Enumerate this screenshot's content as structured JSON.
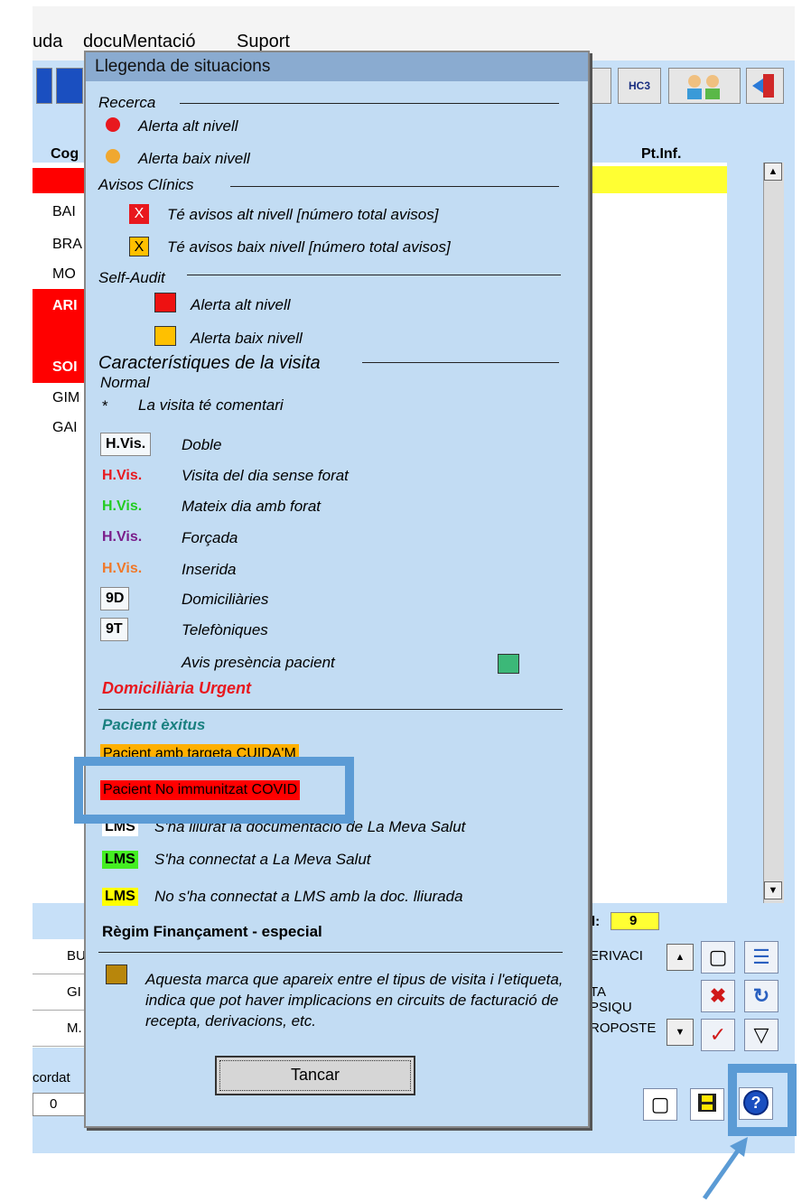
{
  "menubar": {
    "items": [
      "uda",
      "docuMentació",
      "Suport"
    ]
  },
  "toolbar": {
    "hc3_label": "HC3"
  },
  "grid": {
    "header_cog": "Cog",
    "header_ptinf": "Pt.Inf.",
    "rows": [
      "BAI",
      "BRA",
      "MO",
      "ARI",
      "SOI",
      "GIM",
      "GAI"
    ]
  },
  "counter": {
    "label": "l:",
    "value": "9"
  },
  "bottom_table": {
    "rows": [
      {
        "col1": "BU",
        "col2": "ERIVACI"
      },
      {
        "col1": "GI",
        "col2": "TA PSIQU"
      },
      {
        "col1": "M.",
        "col2": "ROPOSTE"
      }
    ]
  },
  "footer": {
    "label": "cordat",
    "value": "0"
  },
  "dialog": {
    "title": "Llegenda de situacions",
    "recerca": {
      "header": "Recerca",
      "items": [
        "Alerta alt nivell",
        "Alerta baix nivell"
      ],
      "colors": [
        "#e8181e",
        "#f0a830"
      ]
    },
    "avisos": {
      "header": "Avisos Clínics",
      "items": [
        {
          "mark": "X",
          "text": "Té avisos alt nivell  [número total avisos]",
          "color": "#e8181e"
        },
        {
          "mark": "X",
          "text": "Té avisos baix nivell  [número total avisos]",
          "color": "#ffc000"
        }
      ]
    },
    "self_audit": {
      "header": "Self-Audit",
      "items": [
        "Alerta alt nivell",
        "Alerta baix nivell"
      ],
      "colors": [
        "#ee1111",
        "#ffc000"
      ]
    },
    "caracteristiques": {
      "header": "Característiques de la visita",
      "normal": "Normal",
      "comment_star": "*",
      "comment_text": "La visita té comentari",
      "rows": [
        {
          "badge": "H.Vis.",
          "text": "Doble",
          "color": "#000000",
          "boxed": true
        },
        {
          "badge": "H.Vis.",
          "text": "Visita del dia sense forat",
          "color": "#e8181e",
          "boxed": false
        },
        {
          "badge": "H.Vis.",
          "text": "Mateix dia amb forat",
          "color": "#22cc22",
          "boxed": false
        },
        {
          "badge": "H.Vis.",
          "text": "Forçada",
          "color": "#7a1e8a",
          "boxed": false
        },
        {
          "badge": "H.Vis.",
          "text": "Inserida",
          "color": "#f07828",
          "boxed": false
        },
        {
          "badge": "9D",
          "text": "Domiciliàries",
          "color": "#000000",
          "boxed": true
        },
        {
          "badge": "9T",
          "text": "Telefòniques",
          "color": "#000000",
          "boxed": true
        }
      ],
      "presencia": "Avis presència pacient",
      "presencia_color": "#3cb878",
      "urgent": "Domiciliària Urgent"
    },
    "pacient_exitus": "Pacient èxitus",
    "cuidam": "Pacient amb targeta CUIDA'M",
    "covid": "Pacient No immunitzat COVID",
    "lms_rows": [
      {
        "badge": "LMS",
        "text": "S'ha lliurat la documentació de La Meva Salut",
        "bg": "#ffffff"
      },
      {
        "badge": "LMS",
        "text": "S'ha connectat a La Meva Salut",
        "bg": "#44ee22"
      },
      {
        "badge": "LMS",
        "text": "No s'ha connectat a LMS amb la doc. lliurada",
        "bg": "#ffff00"
      }
    ],
    "regim": "Règim Finançament  -  especial",
    "regim_text": "Aquesta marca que apareix entre el tipus de visita i l'etiqueta, indica que pot haver implicacions en circuits de facturació de recepta, derivacions, etc.",
    "regim_color": "#b8860b",
    "close_button": "Tancar"
  },
  "annotation_color": "#5b9bd5"
}
